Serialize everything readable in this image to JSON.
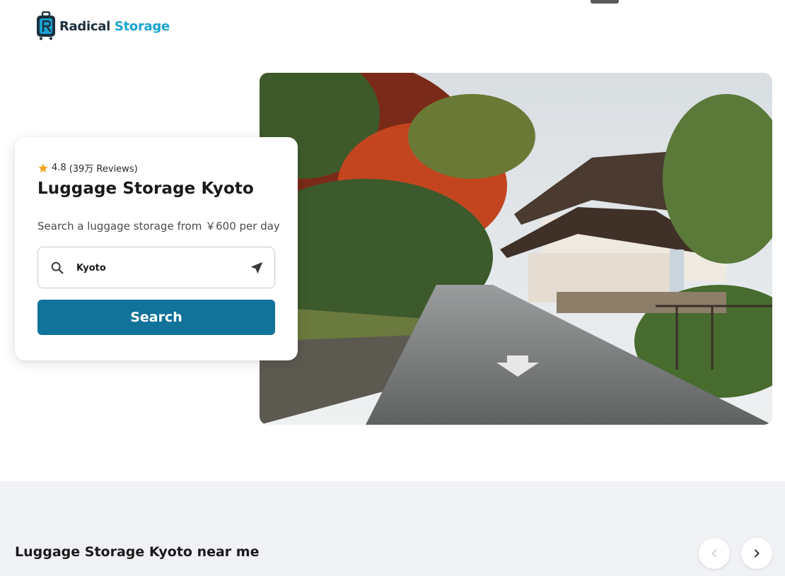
{
  "header": {
    "logo": {
      "word1": "Radical",
      "word2": "Storage",
      "icon": "suitcase-logo-icon"
    }
  },
  "hero": {
    "image": "kyoto-street-with-autumn-trees-and-temple"
  },
  "card": {
    "rating_value": "4.8",
    "rating_reviews": "(39万 Reviews)",
    "title": "Luggage Storage Kyoto",
    "subtitle": "Search a luggage storage from ￥600 per day",
    "search": {
      "value": "Kyoto",
      "placeholder": ""
    },
    "search_button": "Search"
  },
  "near_section": {
    "title": "Luggage Storage Kyoto near me",
    "prev_icon": "chevron-left-icon",
    "next_icon": "chevron-right-icon"
  },
  "colors": {
    "brand_dark": "#1c2f3d",
    "brand_light": "#1aa3d2",
    "button": "#11729a",
    "star": "#f5a623",
    "section_bg": "#f0f2f5"
  }
}
